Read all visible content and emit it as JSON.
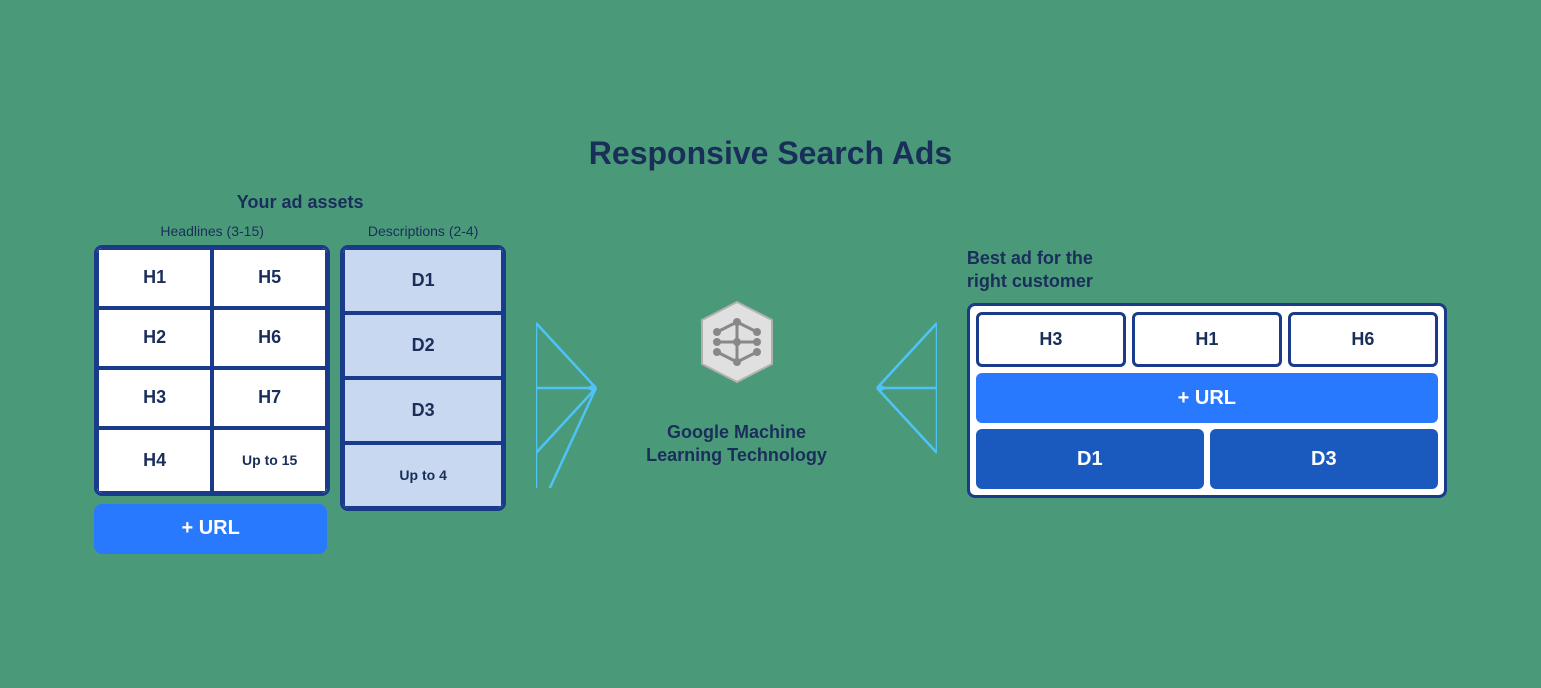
{
  "page": {
    "title": "Responsive Search Ads",
    "background_color": "#4a9a7a"
  },
  "ad_assets": {
    "label": "Your ad assets",
    "headlines": {
      "label": "Headlines (3-15)",
      "cells": [
        "H1",
        "H2",
        "H3",
        "H4",
        "H5",
        "H6",
        "H7",
        "Up to 15"
      ]
    },
    "descriptions": {
      "label": "Descriptions (2-4)",
      "cells": [
        "D1",
        "D2",
        "D3",
        "Up to 4"
      ]
    },
    "url_label": "+ URL"
  },
  "brain": {
    "label": "Google Machine\nLearning Technology"
  },
  "best_ad": {
    "label": "Best ad for the\nright customer",
    "headlines": [
      "H3",
      "H1",
      "H6"
    ],
    "url_label": "+ URL",
    "descriptions": [
      "D1",
      "D3"
    ]
  }
}
